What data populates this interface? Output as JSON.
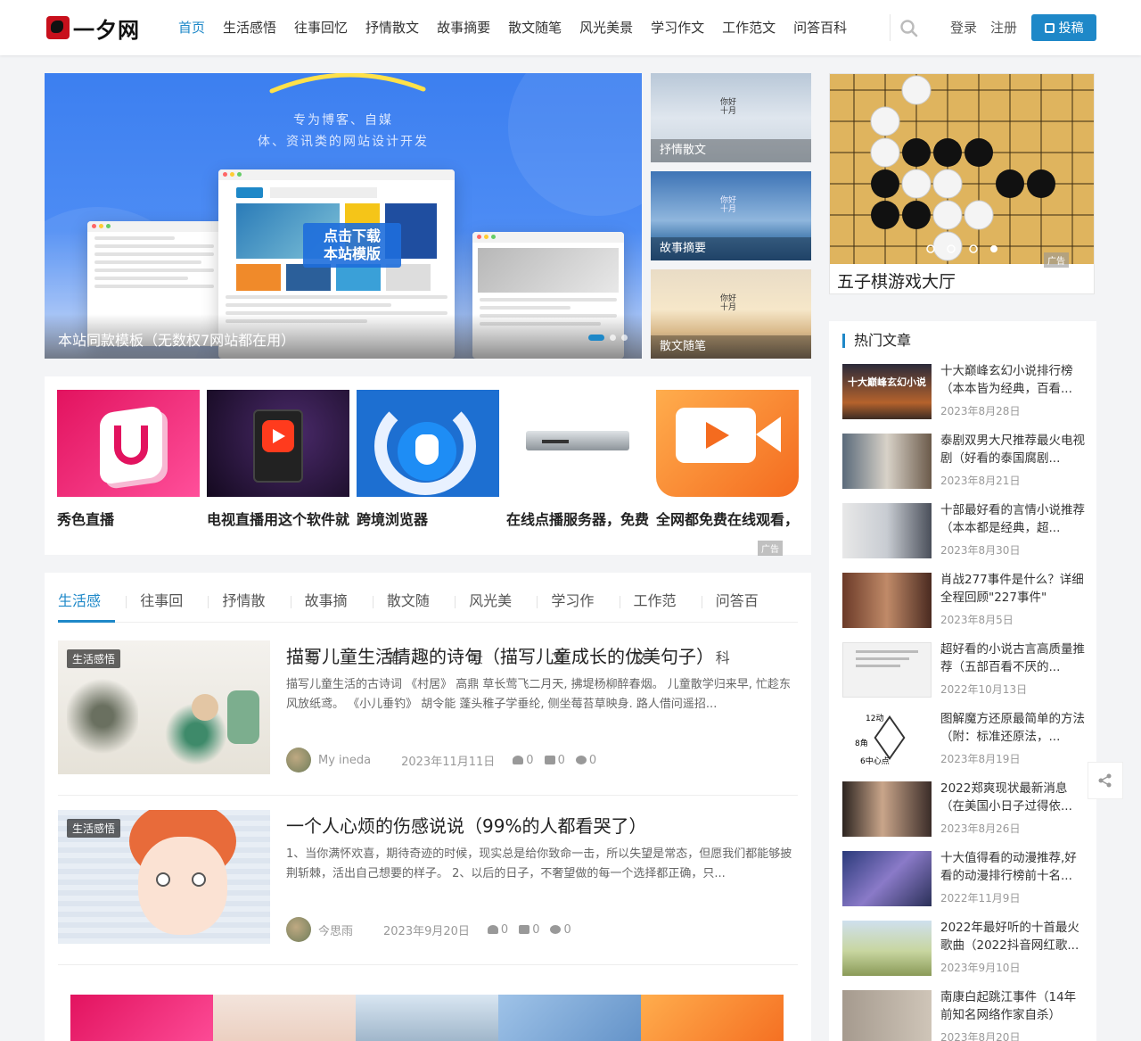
{
  "site": {
    "logo_text": "一夕网"
  },
  "nav": {
    "items": [
      "首页",
      "生活感悟",
      "往事回忆",
      "抒情散文",
      "故事摘要",
      "散文随笔",
      "风光美景",
      "学习作文",
      "工作范文",
      "问答百科"
    ],
    "login": "登录",
    "register": "注册",
    "post_button": "投稿"
  },
  "banner": {
    "headline_1": "专为博客、自媒",
    "headline_2": "体、资讯类的网站设计开发",
    "cta_line1": "点击下载",
    "cta_line2": "本站模版",
    "caption": "本站同款模板（无数权7网站都在用）"
  },
  "side_features": [
    {
      "label": "抒情散文",
      "mark": "你好\n十月"
    },
    {
      "label": "故事摘要",
      "mark": "你好\n十月"
    },
    {
      "label": "散文随笔",
      "mark": "你好\n十月"
    }
  ],
  "gomoku": {
    "title": "五子棋游戏大厅",
    "ad_label": "广告"
  },
  "apps": {
    "items": [
      "秀色直播",
      "电视直播用这个软件就",
      "跨境浏览器",
      "在线点播服务器，免费",
      "全网都免费在线观看，"
    ],
    "ad_label": "广告"
  },
  "category_tabs": [
    "生活感悟",
    "往事回忆",
    "抒情散文",
    "故事摘要",
    "散文随笔",
    "风光美景",
    "学习作文",
    "工作范文",
    "问答百科"
  ],
  "posts": [
    {
      "category": "生活感悟",
      "title": "描写儿童生活情趣的诗句（描写儿童成长的优美句子）",
      "excerpt": "描写儿童生活的古诗词 《村居》 高鼎 草长莺飞二月天, 拂堤杨柳醉春烟。 儿童散学归来早, 忙趁东风放纸鸢。 《小儿垂钓》 胡令能 蓬头稚子学垂纶, 侧坐莓苔草映身. 路人借问遥招...",
      "author": "My ineda",
      "date": "2023年11月11日",
      "likes": "0",
      "thumbs": "0",
      "comments": "0"
    },
    {
      "category": "生活感悟",
      "title": "一个人心烦的伤感说说（99%的人都看哭了）",
      "excerpt": "1、当你满怀欢喜，期待奇迹的时候，现实总是给你致命一击，所以失望是常态，但愿我们都能够披荆斩棘，活出自己想要的样子。 2、以后的日子，不奢望做的每一个选择都正确，只...",
      "author": "今思雨",
      "date": "2023年9月20日",
      "likes": "0",
      "thumbs": "0",
      "comments": "0"
    }
  ],
  "hot": {
    "title": "热门文章",
    "items": [
      {
        "title": "十大巅峰玄幻小说排行榜（本本皆为经典，百看...",
        "date": "2023年8月28日",
        "thumb_text": "十大巅峰玄幻小说"
      },
      {
        "title": "泰剧双男大尺推荐最火电视剧（好看的泰国腐剧...",
        "date": "2023年8月21日"
      },
      {
        "title": "十部最好看的言情小说推荐（本本都是经典，超...",
        "date": "2023年8月30日"
      },
      {
        "title": "肖战277事件是什么？详细全程回顾\"227事件\"",
        "date": "2023年8月5日"
      },
      {
        "title": "超好看的小说古言高质量推荐（五部百看不厌的...",
        "date": "2022年10月13日"
      },
      {
        "title": "图解魔方还原最简单的方法（附：标准还原法，...",
        "date": "2023年8月19日",
        "thumb_labels": [
          "12动",
          "8角",
          "6中心点"
        ]
      },
      {
        "title": "2022郑爽现状最新消息（在美国小日子过得依...",
        "date": "2023年8月26日"
      },
      {
        "title": "十大值得看的动漫推荐,好看的动漫排行榜前十名...",
        "date": "2022年11月9日"
      },
      {
        "title": "2022年最好听的十首最火歌曲（2022抖音网红歌...",
        "date": "2023年9月10日"
      },
      {
        "title": "南康白起跳江事件（14年前知名网络作家自杀）",
        "date": "2023年8月20日"
      }
    ]
  },
  "colors": {
    "accent": "#1e88c8"
  }
}
